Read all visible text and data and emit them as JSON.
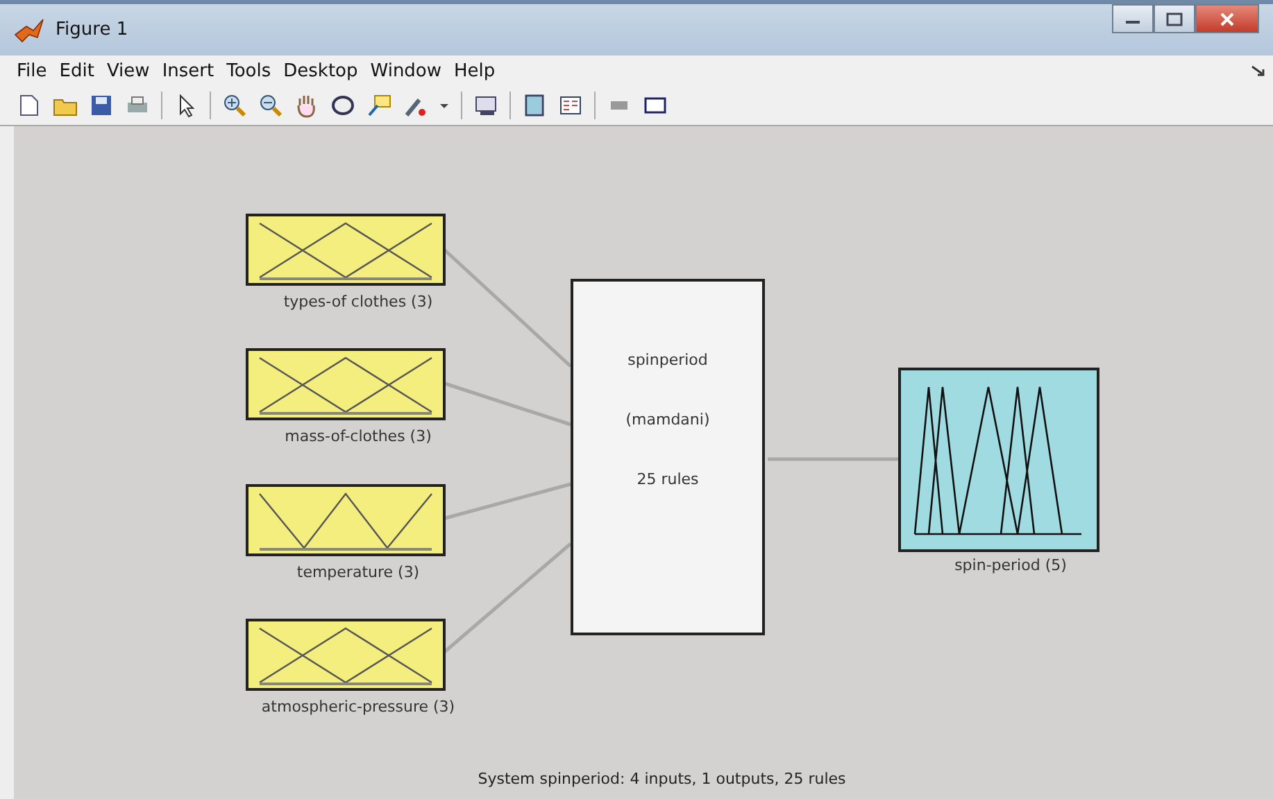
{
  "window": {
    "title": "Figure 1"
  },
  "menu": [
    "File",
    "Edit",
    "View",
    "Insert",
    "Tools",
    "Desktop",
    "Window",
    "Help"
  ],
  "inputs": [
    {
      "label": "types-of clothes (3)",
      "kind": "cross"
    },
    {
      "label": "mass-of-clothes (3)",
      "kind": "cross"
    },
    {
      "label": "temperature (3)",
      "kind": "peak"
    },
    {
      "label": "atmospheric-pressure (3)",
      "kind": "cross"
    }
  ],
  "system": {
    "name": "spinperiod",
    "method": "(mamdani)",
    "rules": "25 rules"
  },
  "outputs": [
    {
      "label": "spin-period (5)",
      "kind": "peaks"
    }
  ],
  "status_bar": "System spinperiod: 4 inputs, 1 outputs, 25 rules"
}
